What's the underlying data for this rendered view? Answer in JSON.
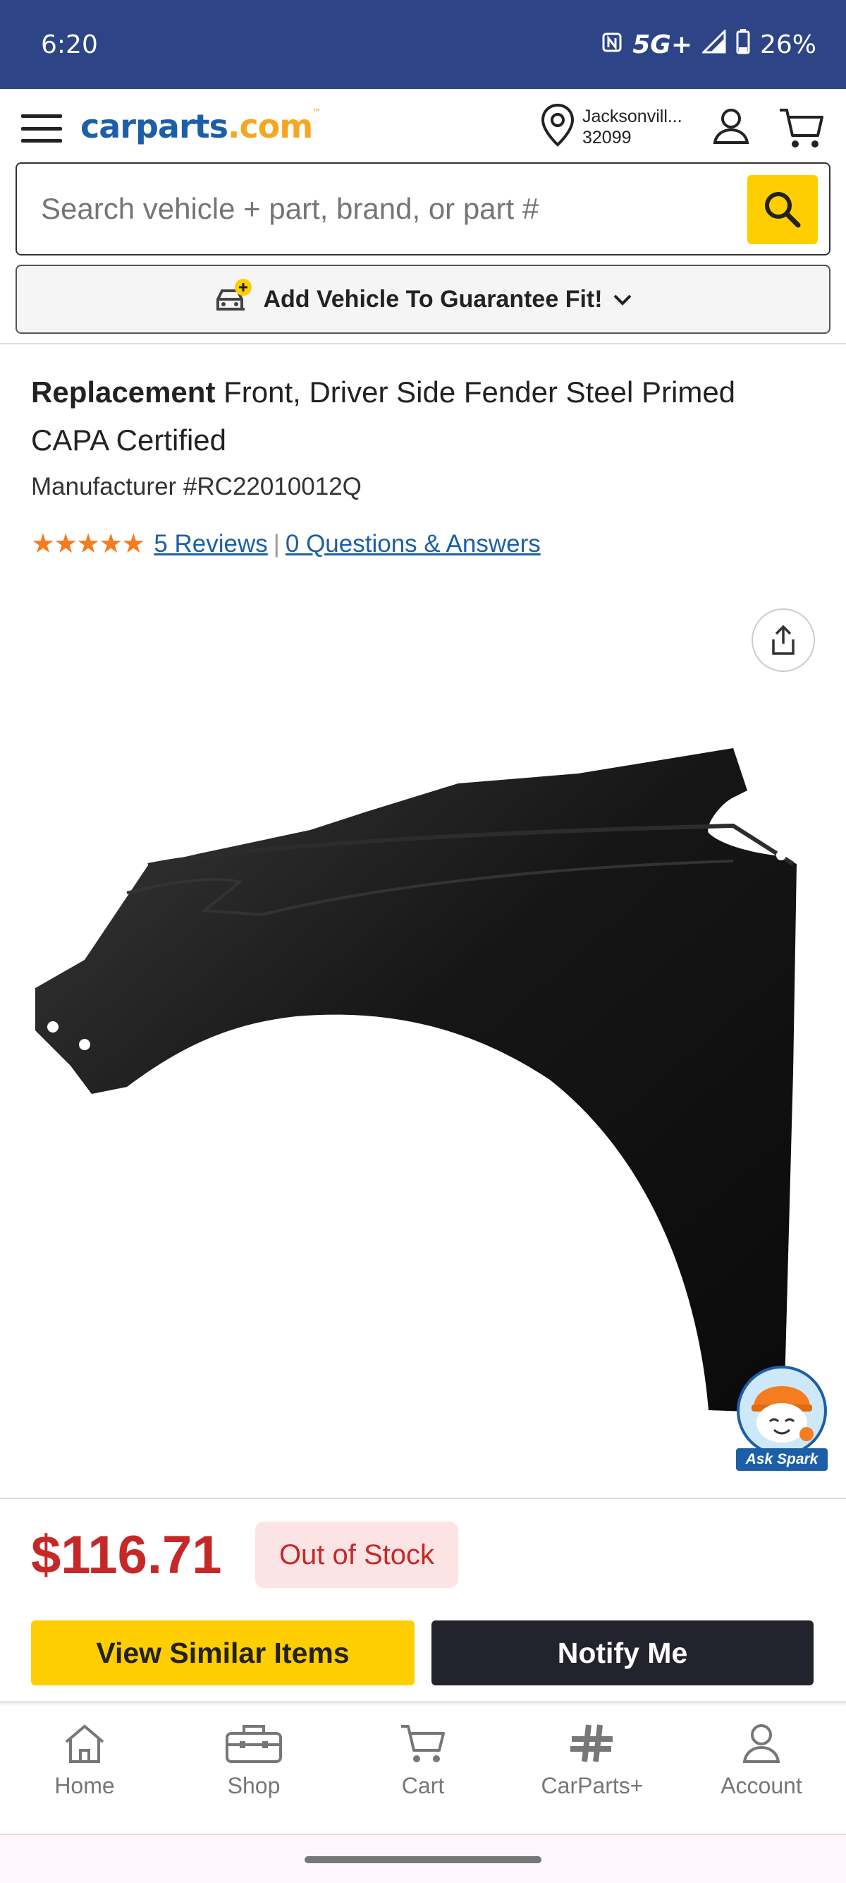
{
  "status_bar": {
    "time": "6:20",
    "network": "5G+",
    "battery": "26%",
    "icons": [
      "nfc-icon",
      "signal-icon",
      "battery-icon"
    ]
  },
  "header": {
    "logo_main": "carparts",
    "logo_tld": ".com",
    "logo_tm": "™",
    "location_city": "Jacksonvill...",
    "location_zip": "32099",
    "icons": [
      "menu-icon",
      "location-pin-icon",
      "account-icon",
      "cart-icon"
    ]
  },
  "search": {
    "placeholder": "Search vehicle + part, brand, or part #"
  },
  "vehicle_bar": {
    "label": "Add Vehicle To Guarantee Fit!"
  },
  "product": {
    "title_bold": "Replacement",
    "title_rest": " Front, Driver Side Fender Steel Primed CAPA Certified",
    "manufacturer": "Manufacturer #RC22010012Q",
    "rating": 5,
    "stars_display": "★★★★★",
    "reviews_link": "5 Reviews",
    "qa_link": "0 Questions & Answers",
    "separator": "|",
    "price": "$116.71",
    "stock_status": "Out of Stock"
  },
  "assistant": {
    "label": "Ask Spark"
  },
  "actions": {
    "similar_label": "View Similar Items",
    "notify_label": "Notify Me"
  },
  "bottom_nav": {
    "items": [
      {
        "label": "Home",
        "icon": "home-icon"
      },
      {
        "label": "Shop",
        "icon": "toolbox-icon"
      },
      {
        "label": "Cart",
        "icon": "cart-icon"
      },
      {
        "label": "CarParts+",
        "icon": "carparts-plus-icon"
      },
      {
        "label": "Account",
        "icon": "account-icon"
      }
    ]
  },
  "colors": {
    "status_bar": "#2d4486",
    "brand_blue": "#1c5fa8",
    "brand_yellow": "#ffce00",
    "price_red": "#c62828",
    "star_orange": "#f57c1f"
  }
}
